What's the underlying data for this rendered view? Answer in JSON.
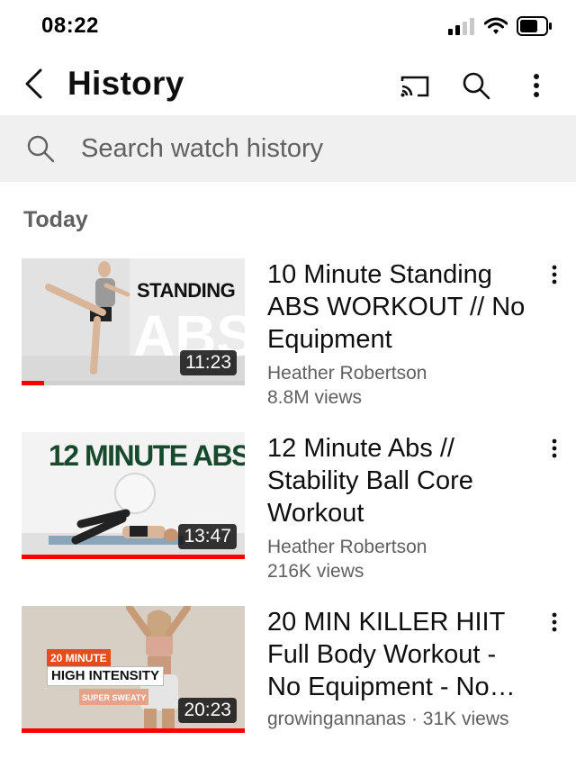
{
  "status_bar": {
    "time": "08:22"
  },
  "header": {
    "title": "History"
  },
  "search": {
    "placeholder": "Search watch history"
  },
  "section": {
    "heading": "Today"
  },
  "colors": {
    "accent": "#ff0000",
    "search_bg": "#f0f0f0",
    "secondary_text": "#606060"
  },
  "videos": [
    {
      "title": "10 Minute Standing ABS WORKOUT // No Equipment",
      "channel": "Heather Robertson",
      "views": "8.8M views",
      "duration": "11:23",
      "thumb_text": [
        "STANDING",
        "ABS"
      ],
      "watched_fraction": 0.1
    },
    {
      "title": "12 Minute Abs // Stability Ball Core Workout",
      "channel": "Heather Robertson",
      "views": "216K views",
      "duration": "13:47",
      "thumb_text": [
        "12 MINUTE ABS"
      ],
      "watched_fraction": 1.0
    },
    {
      "title": "20 MIN KILLER HIIT Full Body Workout - No Equipment - No…",
      "meta": "growingannanas · 31K views",
      "duration": "20:23",
      "thumb_text": [
        "20 MINUTE",
        "HIGH INTENSITY",
        "SUPER SWEATY"
      ],
      "watched_fraction": 1.0
    }
  ]
}
